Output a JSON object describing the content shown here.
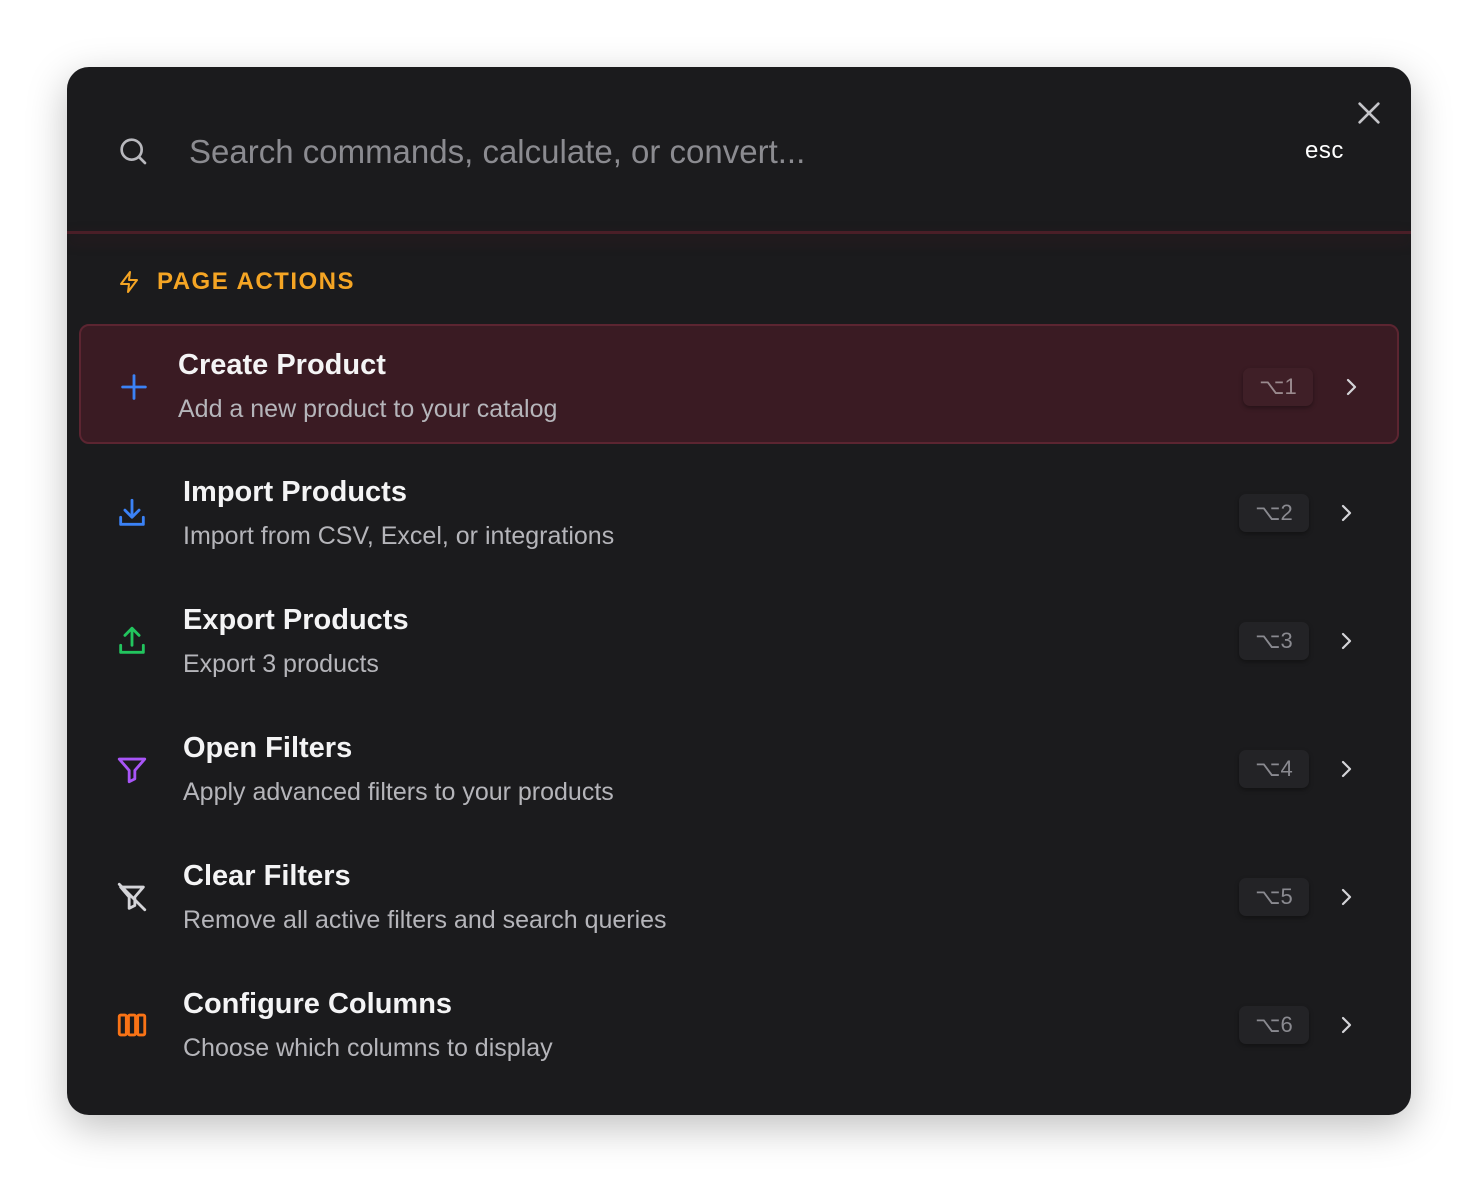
{
  "search": {
    "placeholder": "Search commands, calculate, or convert...",
    "esc_label": "esc"
  },
  "section": {
    "title": "PAGE ACTIONS"
  },
  "items": [
    {
      "title": "Create Product",
      "subtitle": "Add a new product to your catalog",
      "shortcut": "⌥1",
      "icon": "plus-icon",
      "icon_color": "#3b82f6",
      "active": true
    },
    {
      "title": "Import Products",
      "subtitle": "Import from CSV, Excel, or integrations",
      "shortcut": "⌥2",
      "icon": "download-icon",
      "icon_color": "#3b82f6",
      "active": false
    },
    {
      "title": "Export Products",
      "subtitle": "Export 3 products",
      "shortcut": "⌥3",
      "icon": "upload-icon",
      "icon_color": "#22c55e",
      "active": false
    },
    {
      "title": "Open Filters",
      "subtitle": "Apply advanced filters to your products",
      "shortcut": "⌥4",
      "icon": "filter-icon",
      "icon_color": "#a855f7",
      "active": false
    },
    {
      "title": "Clear Filters",
      "subtitle": "Remove all active filters and search queries",
      "shortcut": "⌥5",
      "icon": "filter-off-icon",
      "icon_color": "#d4d4d8",
      "active": false
    },
    {
      "title": "Configure Columns",
      "subtitle": "Choose which columns to display",
      "shortcut": "⌥6",
      "icon": "columns-icon",
      "icon_color": "#f97316",
      "active": false
    }
  ],
  "colors": {
    "background": "#1b1b1d",
    "accent": "#f5a524",
    "active_row": "#3a1b23"
  }
}
